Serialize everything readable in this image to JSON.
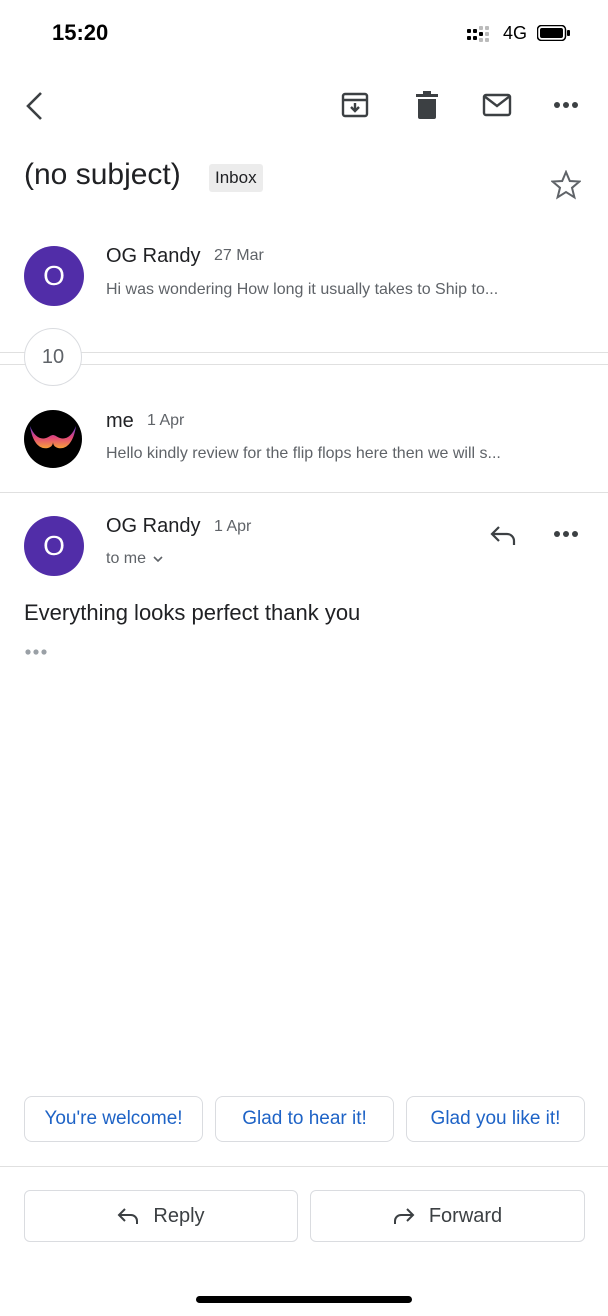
{
  "status_bar": {
    "time": "15:20",
    "network": "4G"
  },
  "toolbar": {
    "back_icon": "chevron-left-icon",
    "archive_icon": "archive-icon",
    "delete_icon": "trash-icon",
    "mark_unread_icon": "mail-icon",
    "more_icon": "more-horizontal-icon"
  },
  "thread": {
    "subject": "(no subject)",
    "label": "Inbox",
    "star_icon": "star-outline-icon"
  },
  "messages": [
    {
      "avatar_letter": "O",
      "sender": "OG Randy",
      "date": "27 Mar",
      "snippet": "Hi was wondering How long it usually takes to Ship to..."
    },
    {
      "sender": "me",
      "date": "1 Apr",
      "snippet": "Hello kindly review for the flip flops here then we will s..."
    }
  ],
  "collapsed_count": "10",
  "open_message": {
    "avatar_letter": "O",
    "sender": "OG Randy",
    "date": "1 Apr",
    "recipient": "to me",
    "body": "Everything looks perfect thank you"
  },
  "smart_replies": [
    "You're welcome!",
    "Glad to hear it!",
    "Glad you like it!"
  ],
  "actions": {
    "reply": "Reply",
    "forward": "Forward"
  },
  "colors": {
    "avatar": "#512da8",
    "smart_reply_text": "#1e63c6"
  }
}
